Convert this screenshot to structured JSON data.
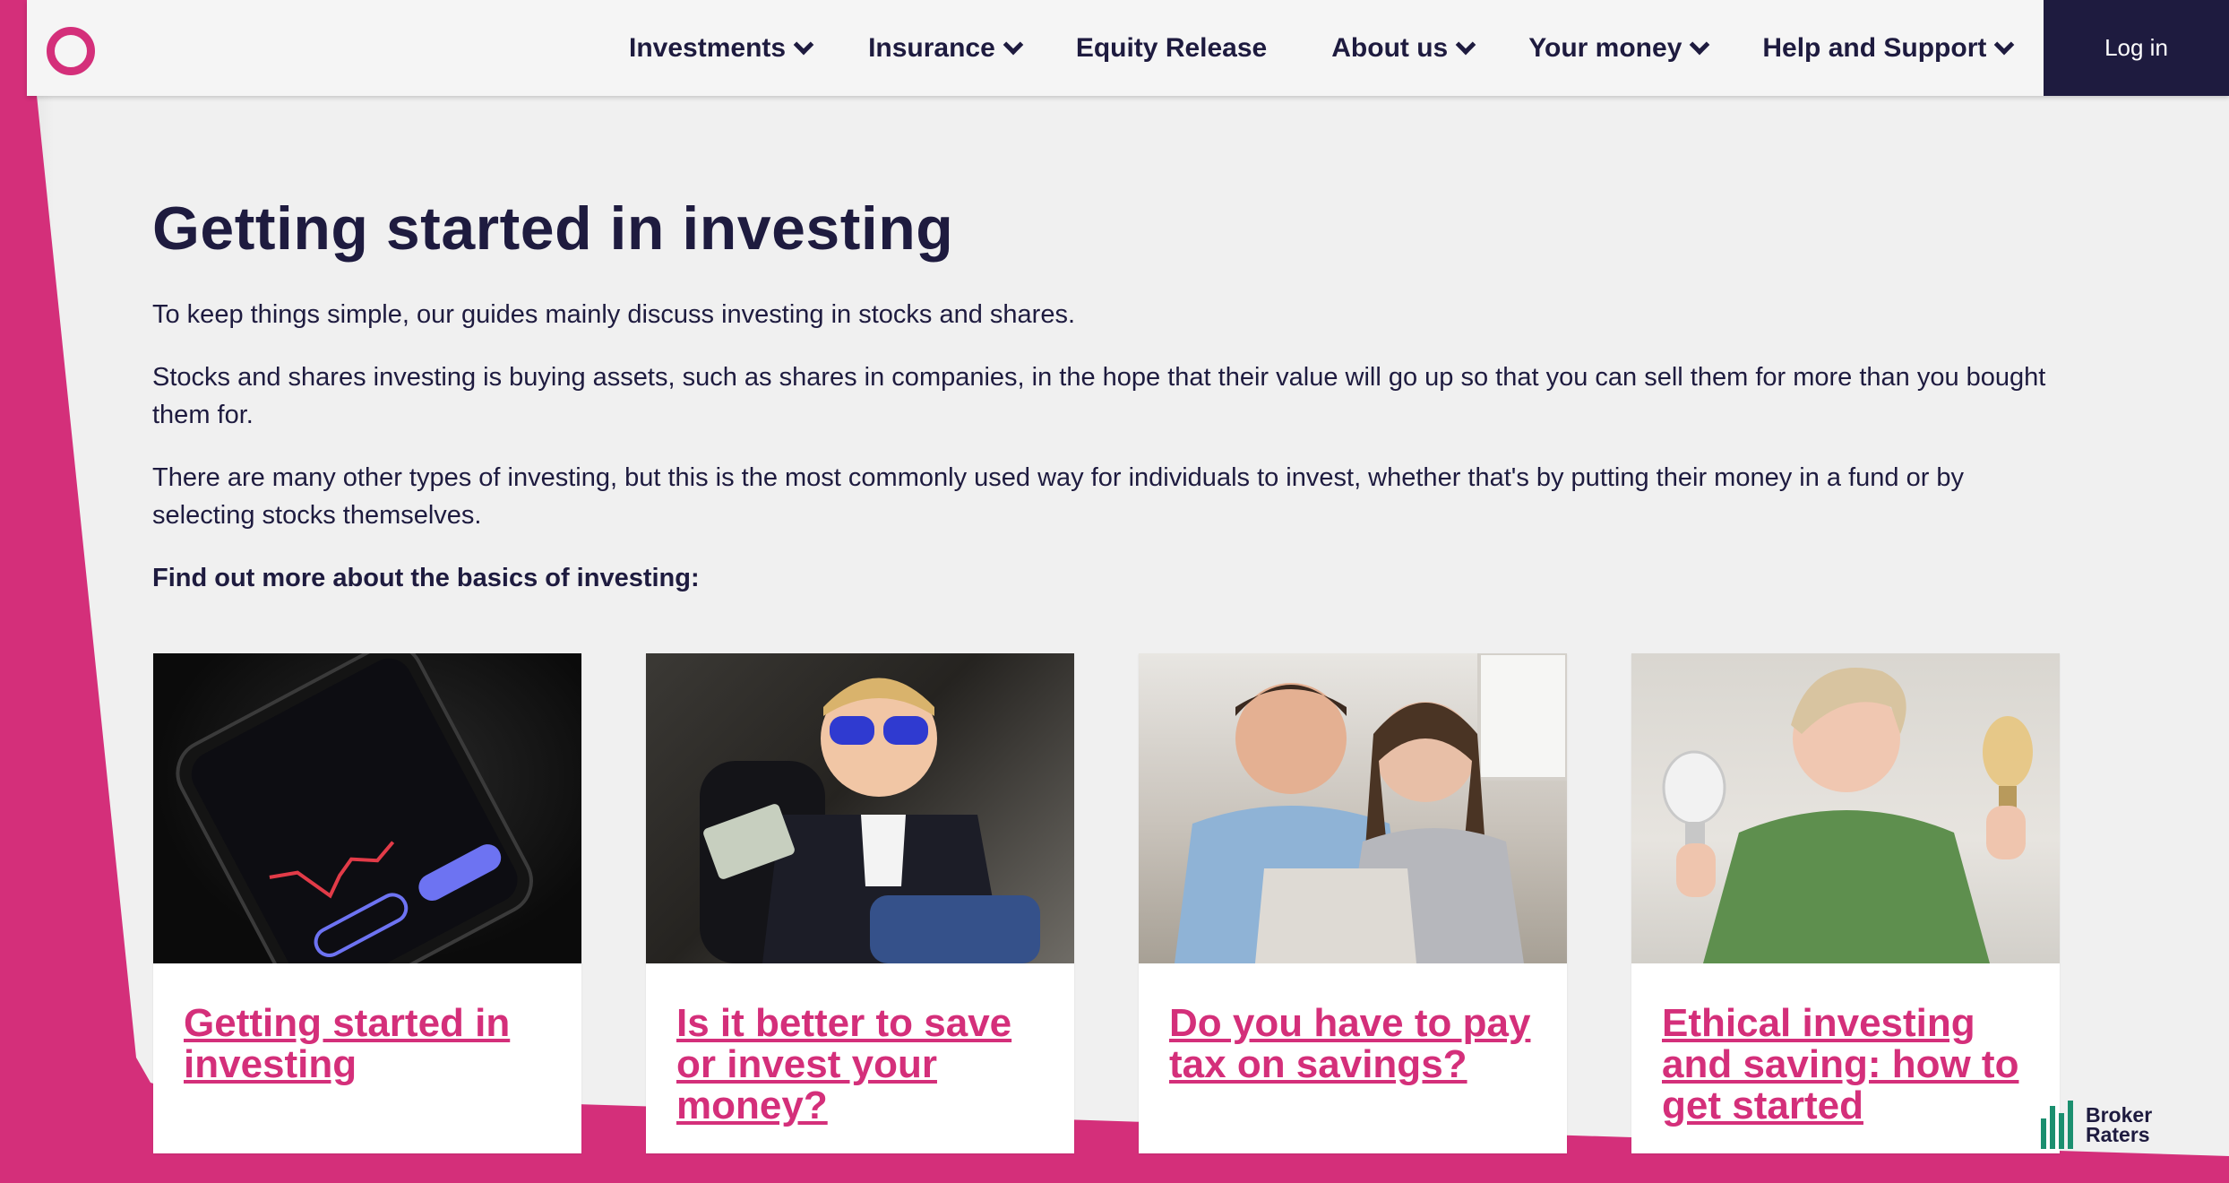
{
  "header": {
    "nav": [
      {
        "label": "Investments",
        "has_dropdown": true
      },
      {
        "label": "Insurance",
        "has_dropdown": true
      },
      {
        "label": "Equity Release",
        "has_dropdown": false
      },
      {
        "label": "About us",
        "has_dropdown": true
      },
      {
        "label": "Your money",
        "has_dropdown": true
      },
      {
        "label": "Help and Support",
        "has_dropdown": true
      }
    ],
    "login_label": "Log in"
  },
  "main": {
    "title": "Getting started in investing",
    "paragraphs": [
      "To keep things simple, our guides mainly discuss investing in stocks and shares.",
      "Stocks and shares investing is buying assets, such as shares in companies, in the hope that their value will go up so that you can sell them for more than you bought them for.",
      "There are many other types of investing, but this is the most commonly used way for individuals to invest, whether that's by putting their money in a fund or by selecting stocks themselves."
    ],
    "find_more": "Find out more about the basics of investing:"
  },
  "cards": [
    {
      "title": "Getting started in investing",
      "image": "phone-showing-ftse-100-chart"
    },
    {
      "title": "Is it better to save or invest your money?",
      "image": "child-in-sunglasses-holding-cash"
    },
    {
      "title": "Do you have to pay tax on savings?",
      "image": "couple-looking-at-laptop"
    },
    {
      "title": "Ethical investing and saving: how to get started",
      "image": "woman-holding-light-bulbs"
    }
  ],
  "badge": {
    "line1": "Broker",
    "line2": "Raters"
  },
  "colors": {
    "brand_pink": "#d42f7a",
    "navy": "#1e1b3f",
    "panel_bg": "#f0f0f0"
  }
}
